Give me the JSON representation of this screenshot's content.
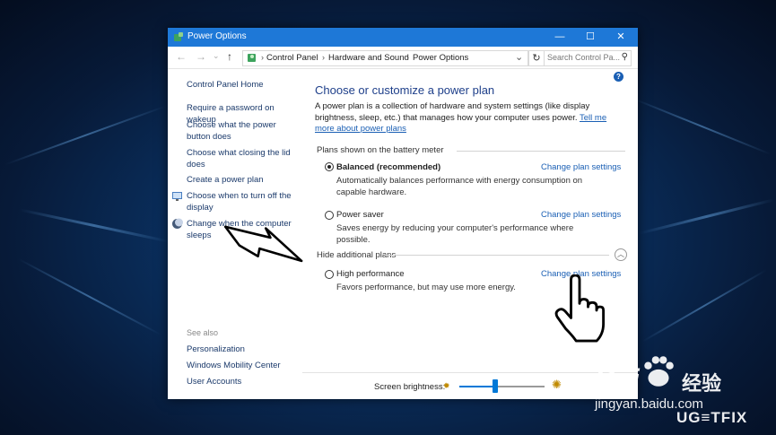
{
  "window": {
    "title": "Power Options",
    "controls": {
      "minimize": "—",
      "maximize": "☐",
      "close": "✕"
    }
  },
  "address": {
    "back": "←",
    "forward": "→",
    "recent": "⌄",
    "up": "↑",
    "crumbs": [
      "Control Panel",
      "Hardware and Sound",
      "Power Options"
    ],
    "separator": "›",
    "dropdown": "⌄",
    "refresh": "↻",
    "search_placeholder": "Search Control Pa...",
    "search_icon": "⚲"
  },
  "sidebar": {
    "home": "Control Panel Home",
    "links": [
      "Require a password on wakeup",
      "Choose what the power button does",
      "Choose what closing the lid does",
      "Create a power plan",
      "Choose when to turn off the display",
      "Change when the computer sleeps"
    ],
    "see_also_label": "See also",
    "see_also": [
      "Personalization",
      "Windows Mobility Center",
      "User Accounts"
    ]
  },
  "main": {
    "help": "?",
    "heading": "Choose or customize a power plan",
    "description": "A power plan is a collection of hardware and system settings (like display brightness, sleep, etc.) that manages how your computer uses power.",
    "description_link": "Tell me more about power plans",
    "battery_group": "Plans shown on the battery meter",
    "additional_group": "Hide additional plans",
    "collapse_icon": "︿",
    "plans": [
      {
        "name": "Balanced (recommended)",
        "desc": "Automatically balances performance with energy consumption on capable hardware.",
        "link": "Change plan settings",
        "selected": true
      },
      {
        "name": "Power saver",
        "desc": "Saves energy by reducing your computer's performance where possible.",
        "link": "Change plan settings",
        "selected": false
      },
      {
        "name": "High performance",
        "desc": "Favors performance, but may use more energy.",
        "link": "Change plan settings",
        "selected": false
      }
    ]
  },
  "bottom": {
    "brightness_label": "Screen brightness:",
    "brightness_level": 0.42,
    "sun_small": "✹",
    "sun_big": "✺"
  },
  "watermarks": {
    "baidu": "Bai",
    "baidu_jingyan": "经验",
    "baidu_url": "jingyan.baidu.com",
    "ugetfix": "UG≡TFIX"
  },
  "colors": {
    "titlebar": "#1e78d7",
    "link": "#1a5fb4",
    "heading": "#1e3f8a"
  }
}
